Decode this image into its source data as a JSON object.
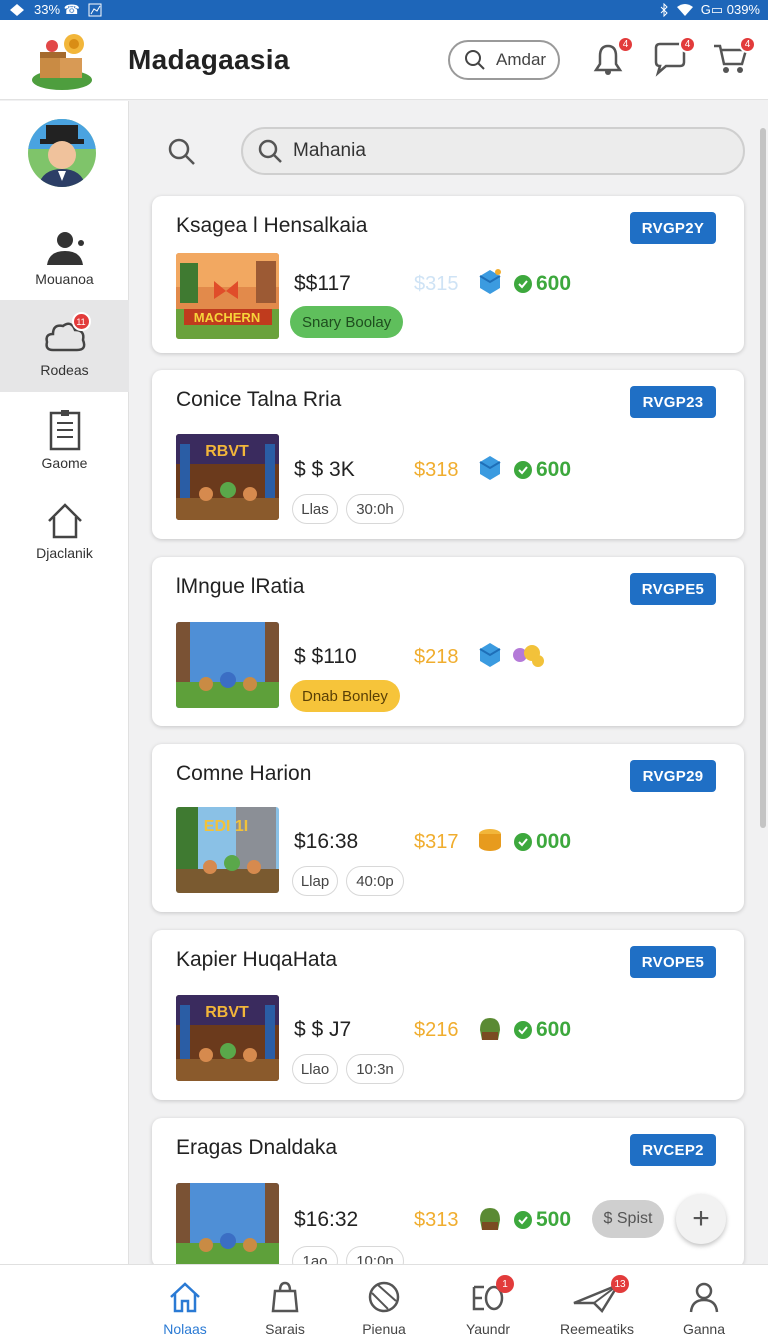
{
  "status": {
    "left_text": "33% ☎",
    "right_text": "G▭ 039%"
  },
  "header": {
    "title": "Madagaasia",
    "search_label": "Amdar",
    "badges": [
      "4",
      "4",
      "4"
    ]
  },
  "sidebar": {
    "items": [
      {
        "label": "Mouanoa",
        "icon": "person-icon"
      },
      {
        "label": "Rodeas",
        "icon": "cloud-icon",
        "badge": "11"
      },
      {
        "label": "Gaome",
        "icon": "document-icon"
      },
      {
        "label": "Djaclanik",
        "icon": "home-icon"
      }
    ]
  },
  "search": {
    "value": "Mahania"
  },
  "cards": [
    {
      "title": "Ksagea l Hensalkaia",
      "code": "RVGP2Y",
      "price": "$$117",
      "price2": "$315",
      "score": "600",
      "tag": "Snary Boolay",
      "thumb_text": "MACHERN"
    },
    {
      "title": "Conice Talna Rria",
      "code": "RVGP23",
      "price": "$ $ 3K",
      "price2": "$318",
      "score": "600",
      "chips": [
        "Llas",
        "30:0h"
      ],
      "thumb_text": "RBVT"
    },
    {
      "title": "lMngue lRatia",
      "code": "RVGPE5",
      "price": "$ $110",
      "price2": "$218",
      "tag": "Dnab Bonley",
      "thumb_text": ""
    },
    {
      "title": "Comne Harion",
      "code": "RVGP29",
      "price": "$16:38",
      "price2": "$317",
      "score": "000",
      "chips": [
        "Llap",
        "40:0p"
      ],
      "thumb_text": "EDI 1I"
    },
    {
      "title": "Kapier HuqaHata",
      "code": "RVOPE5",
      "price": "$ $ J7",
      "price2": "$216",
      "score": "600",
      "chips": [
        "Llao",
        "10:3n"
      ],
      "thumb_text": "RBVT"
    },
    {
      "title": "Eragas Dnaldaka",
      "code": "RVCEP2",
      "price": "$16:32",
      "price2": "$313",
      "score": "500",
      "chips": [
        "1ao",
        "10:0n"
      ],
      "spist": "$ Spist",
      "thumb_text": ""
    }
  ],
  "fab": {
    "label": "+"
  },
  "bottom_nav": [
    {
      "label": "Nolaas",
      "icon": "home-icon",
      "active": true
    },
    {
      "label": "Sarais",
      "icon": "bag-icon"
    },
    {
      "label": "Pienua",
      "icon": "globe-icon"
    },
    {
      "label": "Yaundr",
      "icon": "eo-icon",
      "badge": "1"
    },
    {
      "label": "Reemeatiks",
      "icon": "paper-plane-icon",
      "badge": "13"
    },
    {
      "label": "Ganna",
      "icon": "person-icon"
    }
  ],
  "colors": {
    "accent": "#1f6fc5",
    "green": "#3da83d",
    "gold": "#f0ad2e",
    "badge": "#e23b3b"
  }
}
